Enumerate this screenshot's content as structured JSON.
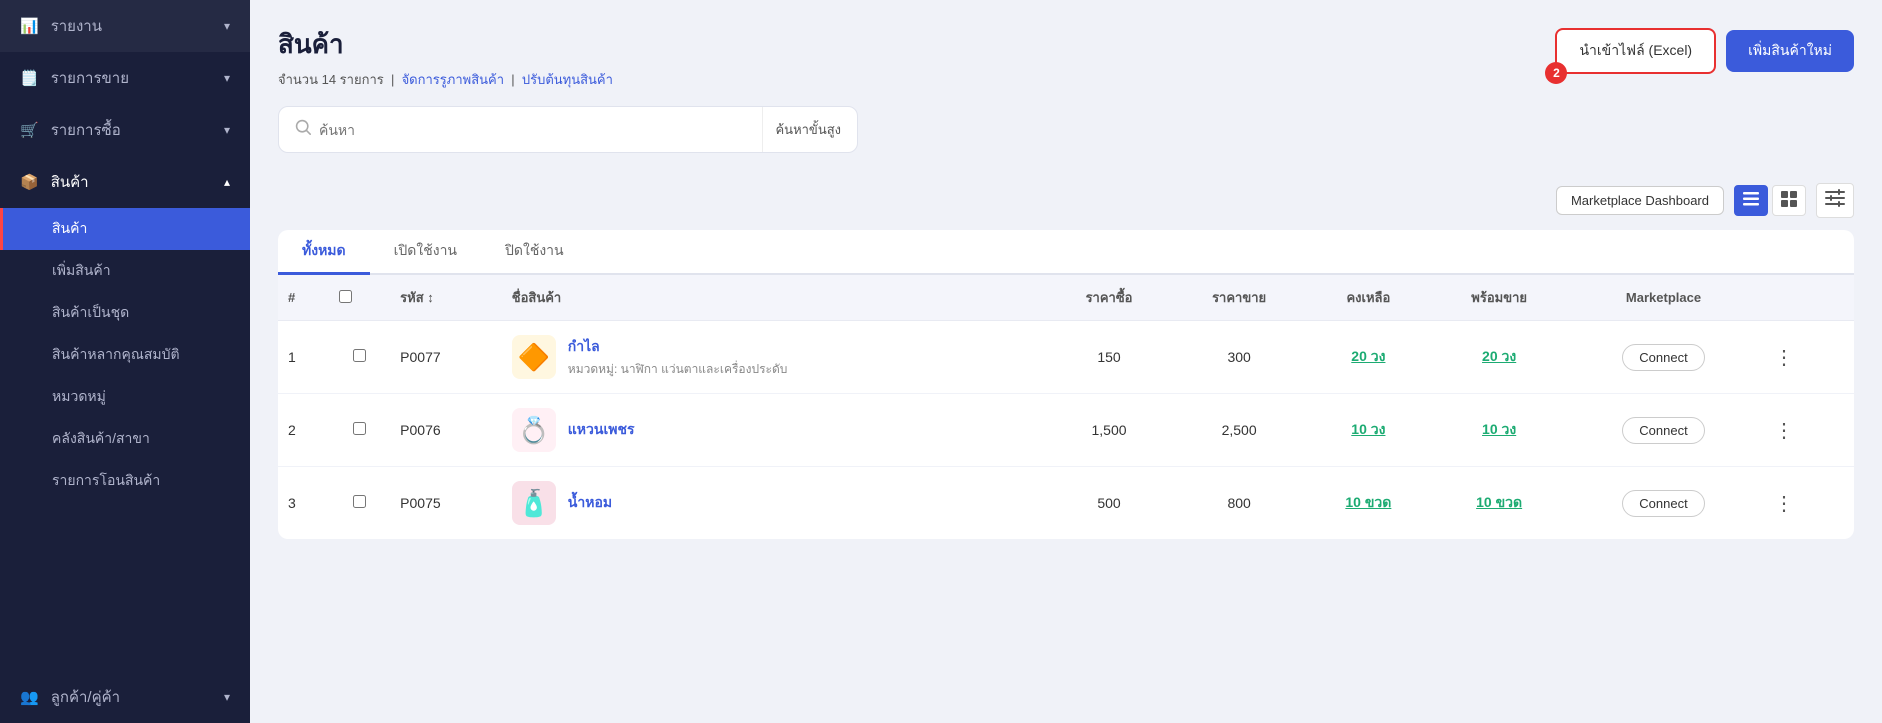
{
  "sidebar": {
    "items": [
      {
        "id": "report",
        "label": "รายงาน",
        "icon": "📊",
        "hasChevron": true
      },
      {
        "id": "sales",
        "label": "รายการขาย",
        "icon": "🗒️",
        "hasChevron": true
      },
      {
        "id": "purchase",
        "label": "รายการซื้อ",
        "icon": "🛒",
        "hasChevron": true
      },
      {
        "id": "product",
        "label": "สินค้า",
        "icon": "📦",
        "hasChevron": true,
        "active": true
      }
    ],
    "subItems": [
      {
        "id": "product-main",
        "label": "สินค้า",
        "active": true
      },
      {
        "id": "add-product",
        "label": "เพิ่มสินค้า",
        "active": false
      },
      {
        "id": "product-set",
        "label": "สินค้าเป็นชุด",
        "active": false
      },
      {
        "id": "product-quality",
        "label": "สินค้าหลากคุณสมบัติ",
        "active": false
      },
      {
        "id": "category",
        "label": "หมวดหมู่",
        "active": false
      },
      {
        "id": "warehouse",
        "label": "คลังสินค้า/สาขา",
        "active": false
      },
      {
        "id": "transfer",
        "label": "รายการโอนสินค้า",
        "active": false
      }
    ],
    "bottomItems": [
      {
        "id": "customer",
        "label": "ลูกค้า/คู่ค้า",
        "icon": "👥",
        "hasChevron": true
      }
    ]
  },
  "page": {
    "title": "สินค้า",
    "subtitle_count": "จำนวน 14 รายการ",
    "subtitle_links": [
      {
        "label": "จัดการรูภาพสินค้า"
      },
      {
        "label": "ปรับต้นทุนสินค้า"
      }
    ],
    "import_btn": "นำเข้าไฟล์ (Excel)",
    "add_btn": "เพิ่มสินค้าใหม่",
    "import_badge": "2",
    "search_placeholder": "ค้นหา",
    "advanced_search": "ค้นหาขั้นสูง",
    "marketplace_btn": "Marketplace Dashboard",
    "tabs": [
      {
        "id": "all",
        "label": "ทั้งหมด",
        "active": true
      },
      {
        "id": "open",
        "label": "เปิดใช้งาน",
        "active": false
      },
      {
        "id": "closed",
        "label": "ปิดใช้งาน",
        "active": false
      }
    ],
    "table": {
      "headers": [
        "#",
        "",
        "รหัส",
        "ชื่อสินค้า",
        "ราคาซื้อ",
        "ราคาขาย",
        "คงเหลือ",
        "พร้อมขาย",
        "Marketplace",
        ""
      ],
      "rows": [
        {
          "num": "1",
          "code": "P0077",
          "name": "กำไล",
          "sub": "หมวดหมู่: นาฬิกา แว่นตาและเครื่องประดับ",
          "buy_price": "150",
          "sell_price": "300",
          "stock": "20 วง",
          "ready": "20 วง",
          "img": "💍",
          "img_type": "gold"
        },
        {
          "num": "2",
          "code": "P0076",
          "name": "แหวนเพชร",
          "sub": "",
          "buy_price": "1,500",
          "sell_price": "2,500",
          "stock": "10 วง",
          "ready": "10 วง",
          "img": "💍",
          "img_type": "ring"
        },
        {
          "num": "3",
          "code": "P0075",
          "name": "น้ำหอม",
          "sub": "",
          "buy_price": "500",
          "sell_price": "800",
          "stock": "10 ขวด",
          "ready": "10 ขวด",
          "img": "🧴",
          "img_type": "perfume"
        }
      ]
    }
  }
}
